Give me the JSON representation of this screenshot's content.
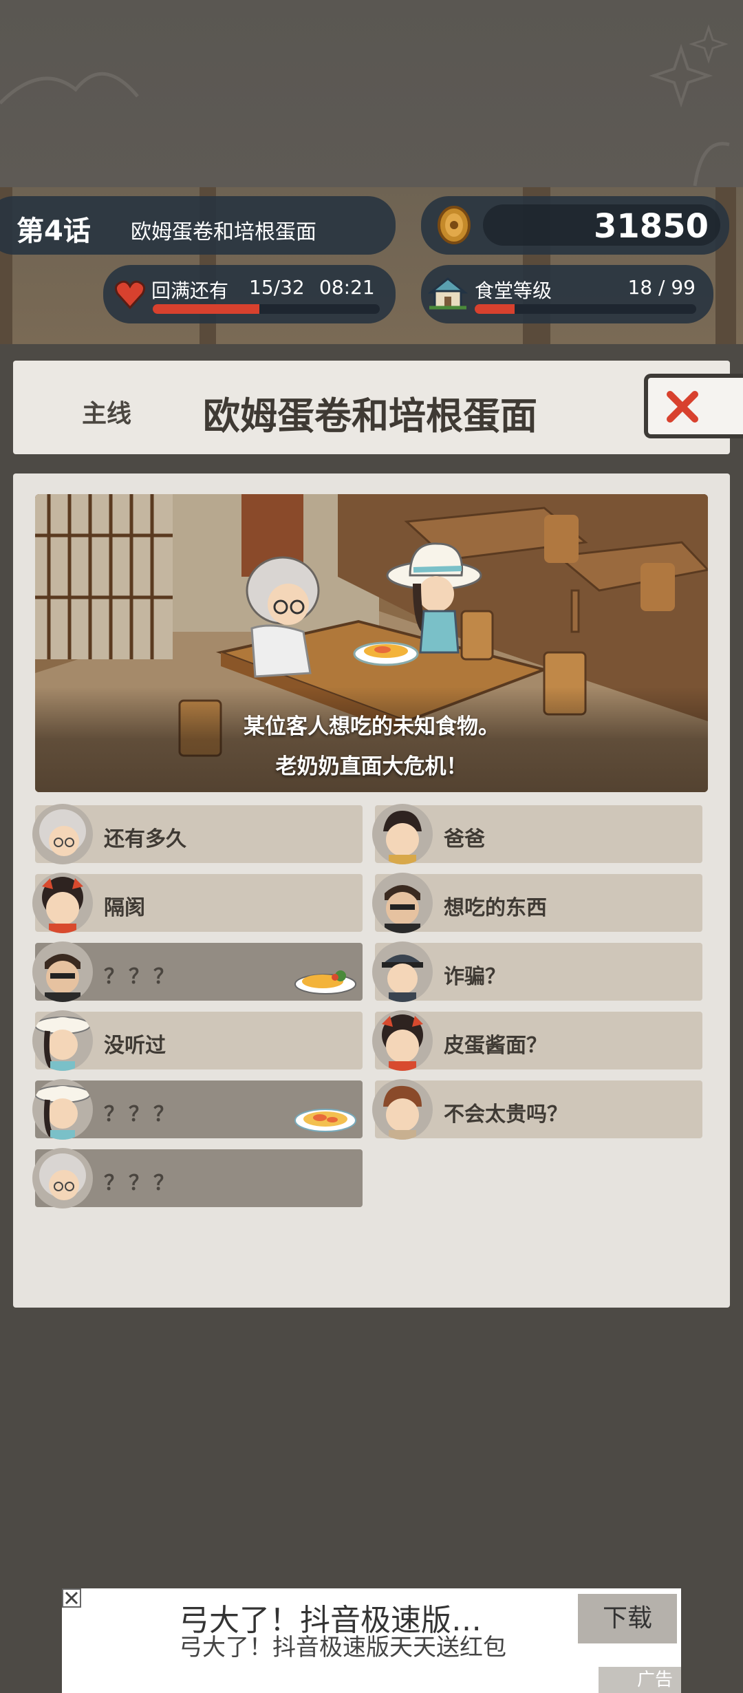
{
  "hud": {
    "episode_number": "第4话",
    "episode_title": "欧姆蛋卷和培根蛋面",
    "coins": "31850",
    "stamina_label": "回满还有",
    "stamina_count": "15/32",
    "stamina_timer": "08:21",
    "stamina_fraction": 0.47,
    "level_label": "食堂等级",
    "level_value": "18 / 99",
    "level_fraction": 0.18
  },
  "header": {
    "type": "主线",
    "title": "欧姆蛋卷和培根蛋面"
  },
  "scene": {
    "caption_line1": "某位客人想吃的未知食物。",
    "caption_line2": "老奶奶直面大危机！"
  },
  "topics_left": [
    {
      "label": "还有多久",
      "avatar": "grandma-avatar-icon",
      "locked": false
    },
    {
      "label": "隔阂",
      "avatar": "girl-red-bow-avatar-icon",
      "locked": false
    },
    {
      "label": "？？？",
      "avatar": "man-sunglasses-avatar-icon",
      "locked": true,
      "dish": "omelette-icon"
    },
    {
      "label": "没听过",
      "avatar": "girl-sunhat-avatar-icon",
      "locked": false
    },
    {
      "label": "？？？",
      "avatar": "girl-sunhat-avatar-icon",
      "locked": true,
      "dish": "carbonara-icon"
    },
    {
      "label": "？？？",
      "avatar": "grandma-avatar-icon",
      "locked": true
    }
  ],
  "topics_right": [
    {
      "label": "爸爸",
      "avatar": "boy-avatar-icon",
      "locked": false
    },
    {
      "label": "想吃的东西",
      "avatar": "man-sunglasses-avatar-icon",
      "locked": false
    },
    {
      "label": "诈骗？",
      "avatar": "officer-cap-avatar-icon",
      "locked": false
    },
    {
      "label": "皮蛋酱面？",
      "avatar": "girl-red-bow-avatar-icon",
      "locked": false
    },
    {
      "label": "不会太贵吗？",
      "avatar": "man-brown-hair-avatar-icon",
      "locked": false
    }
  ],
  "ad": {
    "title": "弓大了！抖音极速版…",
    "text": "弓大了！抖音极速版天天送红包",
    "button": "下载",
    "tag": "广告"
  }
}
